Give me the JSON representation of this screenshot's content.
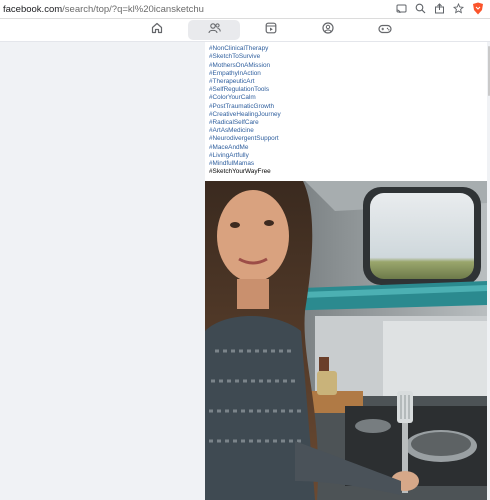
{
  "browser": {
    "url_host": "facebook.com",
    "url_path": "/search/top/?q=kl%20icansketchu"
  },
  "colors": {
    "link": "#2f5f9e",
    "brave_orange": "#fb542b",
    "nav_active_bg": "#e9eaed"
  },
  "nav": {
    "tabs": [
      {
        "icon": "home-icon",
        "active": false
      },
      {
        "icon": "friends-icon",
        "active": true
      },
      {
        "icon": "video-icon",
        "active": false
      },
      {
        "icon": "groups-icon",
        "active": false
      },
      {
        "icon": "gaming-icon",
        "active": false
      }
    ]
  },
  "post": {
    "hashtags": [
      "#NonClinicalTherapy",
      "#SketchToSurvive",
      "#MothersOnAMission",
      "#EmpathyInAction",
      "#TherapeuticArt",
      "#SelfRegulationTools",
      "#ColorYourCalm",
      "#PostTraumaticGrowth",
      "#CreativeHealingJourney",
      "#RadicalSelfCare",
      "#ArtAsMedicine",
      "#NeurodivergentSupport",
      "#MaceAndMe",
      "#LivingArtfully",
      "#MindfulMamas"
    ],
    "final_tag": "#SketchYourWayFree",
    "photo_description_icon": "selfie-photo"
  }
}
